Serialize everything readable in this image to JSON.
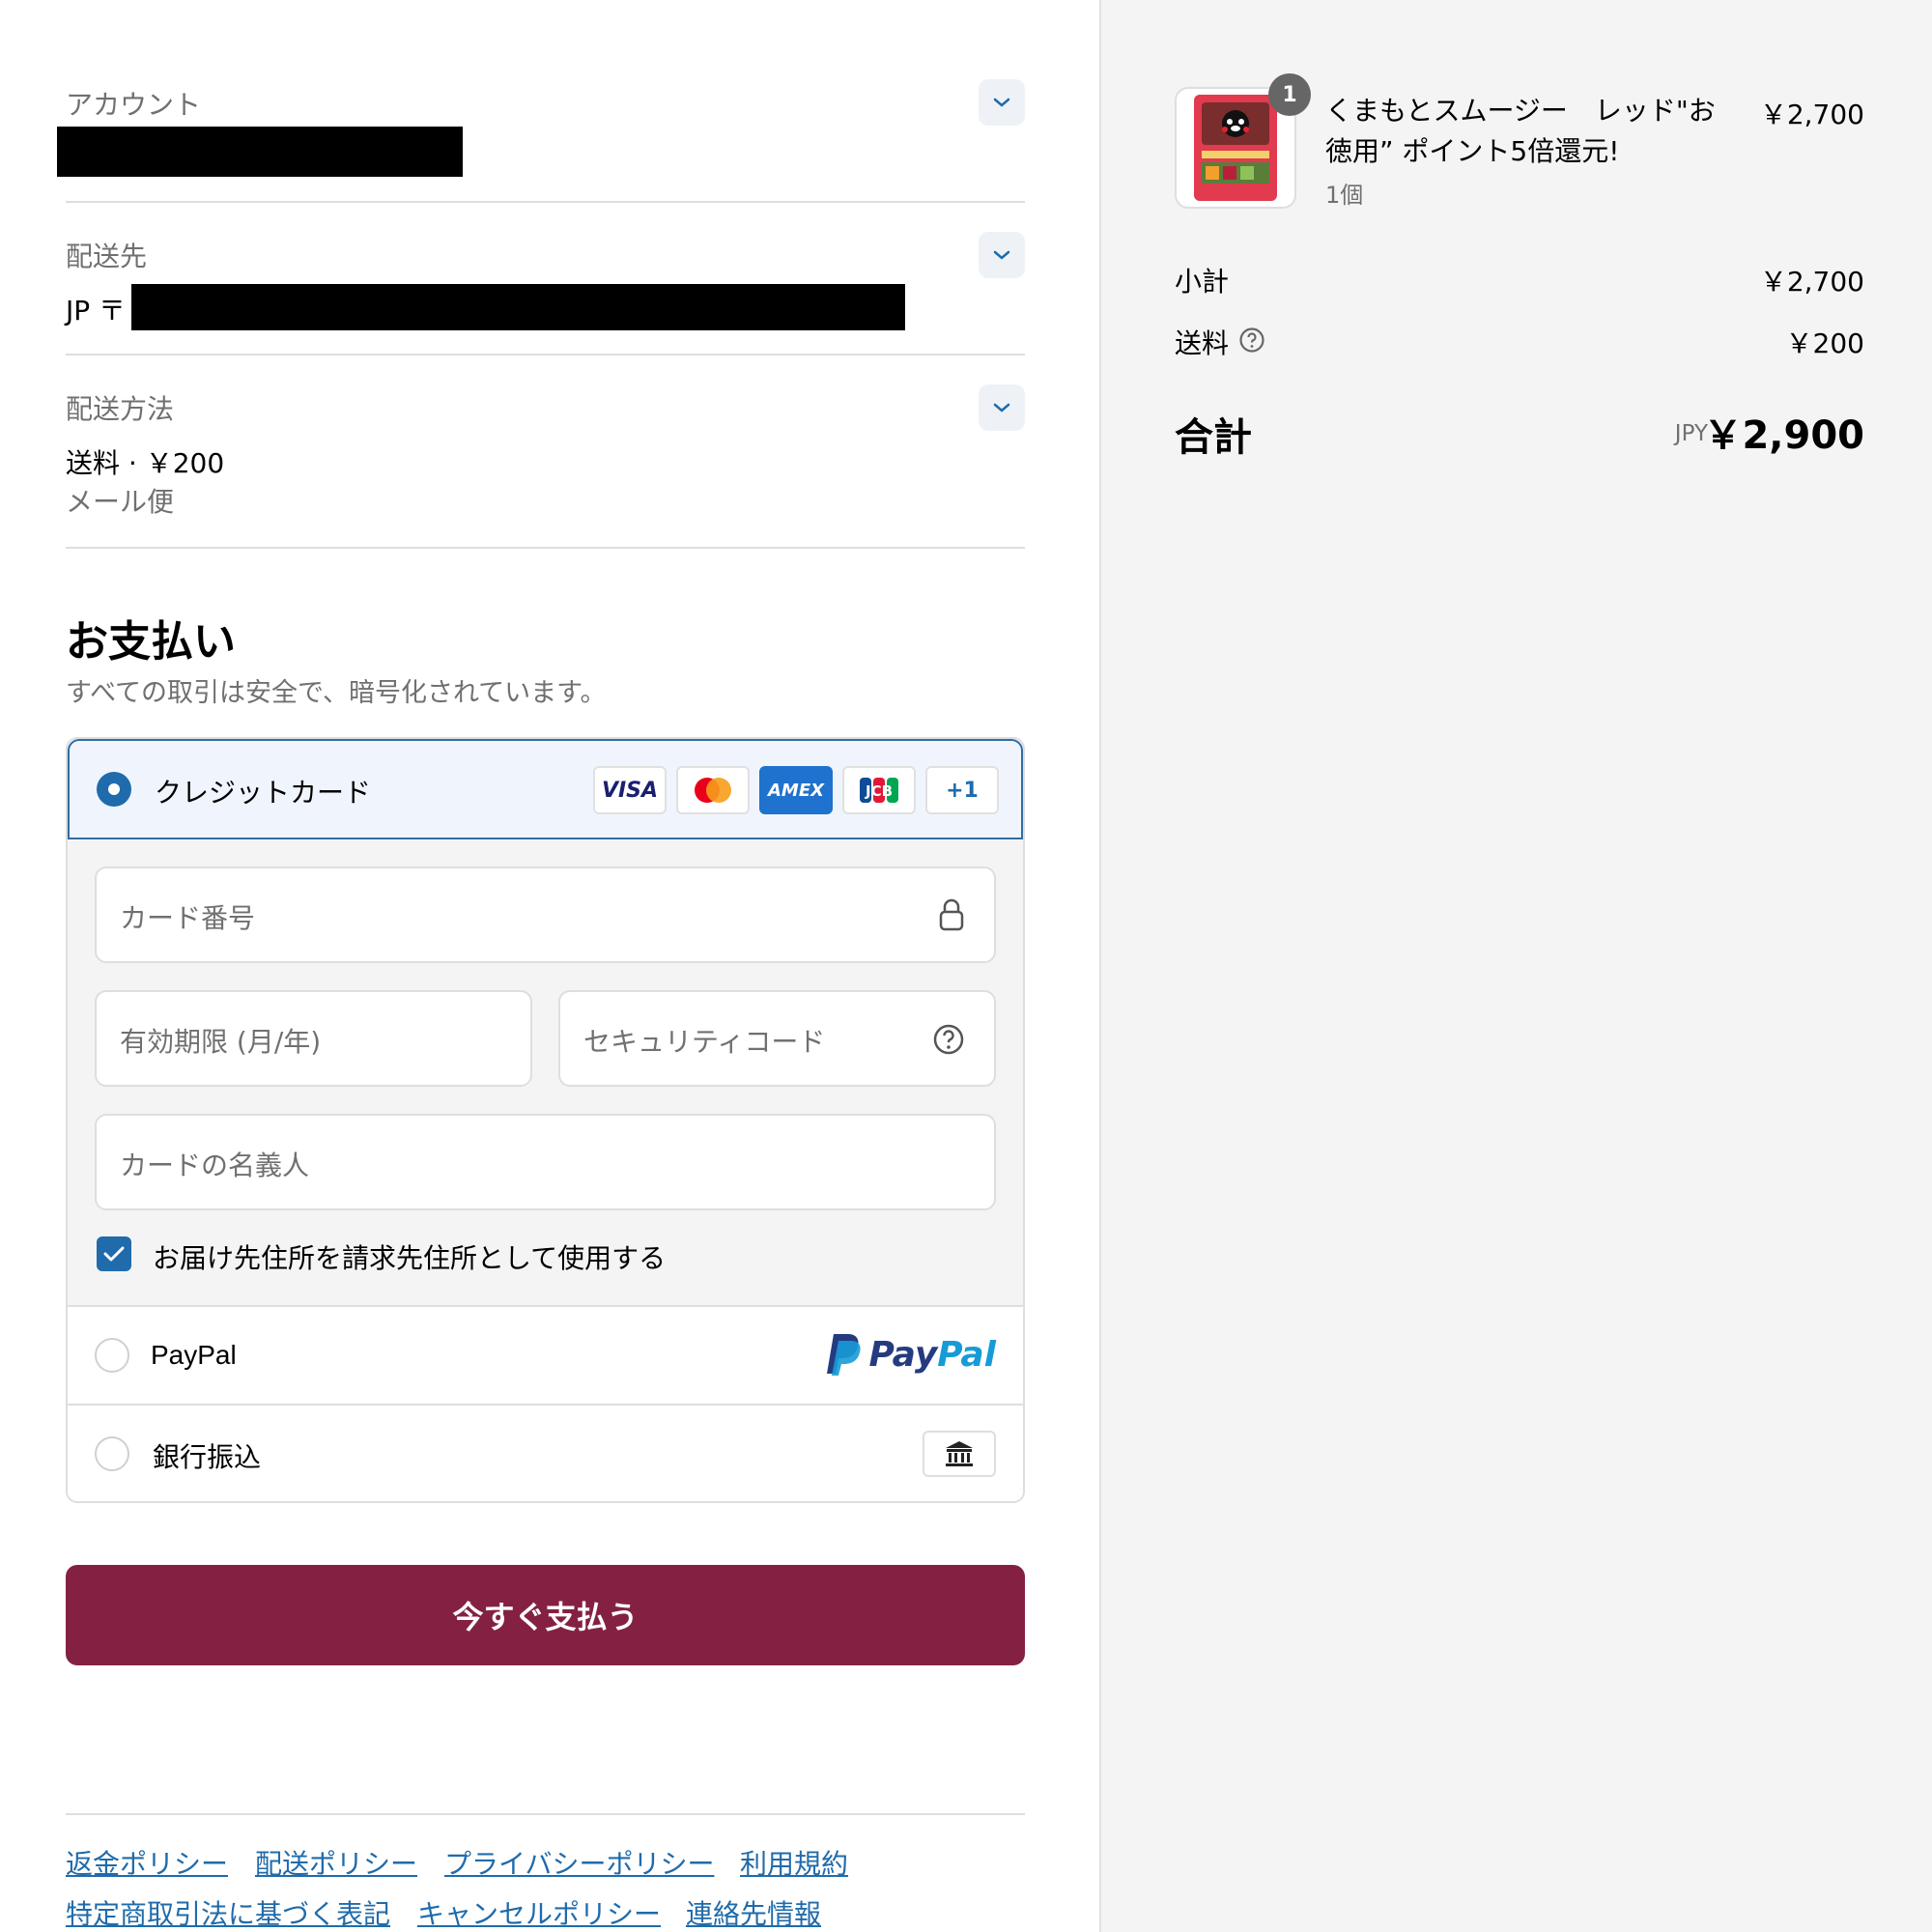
{
  "account": {
    "label": "アカウント"
  },
  "shipping_address": {
    "label": "配送先",
    "prefix": "JP 〒"
  },
  "shipping_method": {
    "label": "配送方法",
    "value": "送料 · ￥200",
    "detail": "メール便"
  },
  "payment": {
    "title": "お支払い",
    "subtitle": "すべての取引は安全で、暗号化されています。",
    "credit_card": {
      "label": "クレジットカード",
      "badges": [
        "VISA",
        "mastercard",
        "AMEX",
        "JCB",
        "+1"
      ],
      "card_number_placeholder": "カード番号",
      "expiry_placeholder": "有効期限 (月/年)",
      "security_code_placeholder": "セキュリティコード",
      "name_placeholder": "カードの名義人",
      "billing_same_label": "お届け先住所を請求先住所として使用する"
    },
    "paypal": {
      "label": "PayPal",
      "logo_text": "PayPal"
    },
    "bank_transfer": {
      "label": "銀行振込"
    },
    "pay_button": "今すぐ支払う"
  },
  "footer_links": [
    "返金ポリシー",
    "配送ポリシー",
    "プライバシーポリシー",
    "利用規約",
    "特定商取引法に基づく表記",
    "キャンセルポリシー",
    "連絡先情報"
  ],
  "order": {
    "item": {
      "name": "くまもとスムージー　レッド\"お徳用” ポイント5倍還元!",
      "quantity": "1個",
      "price": "￥2,700",
      "badge": "1"
    },
    "subtotal_label": "小計",
    "subtotal_value": "￥2,700",
    "shipping_label": "送料",
    "shipping_value": "￥200",
    "total_label": "合計",
    "currency": "JPY",
    "total_value": "￥2,900"
  },
  "colors": {
    "accent": "#1f6bab",
    "pay_button": "#842142",
    "sidebar_bg": "#f4f4f4"
  }
}
